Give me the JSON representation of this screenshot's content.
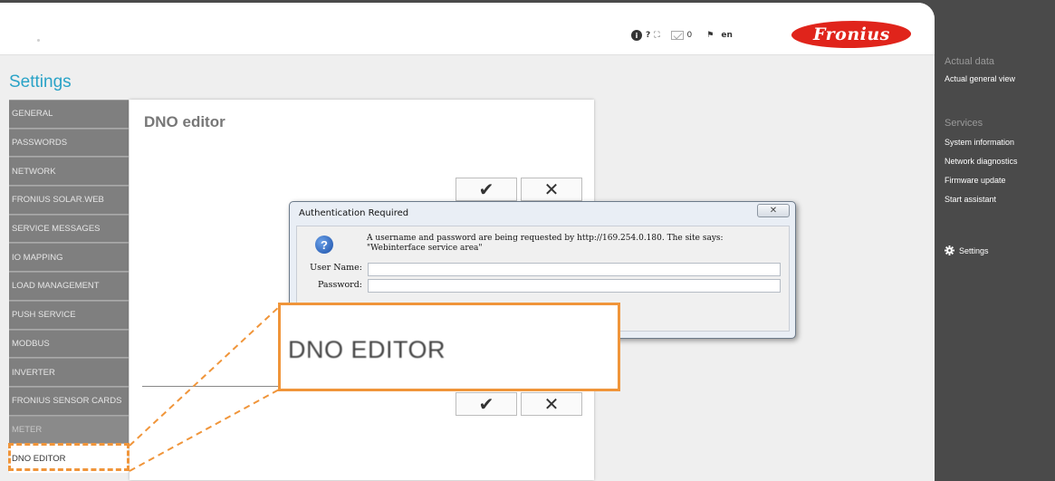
{
  "header": {
    "tools": {
      "info": "i",
      "help": "?",
      "fullscreen": "⛶",
      "mail_count": "0",
      "language": "en"
    },
    "logo_text": "Fronius"
  },
  "page": {
    "title": "Settings"
  },
  "menu": {
    "items": [
      {
        "label": "GENERAL"
      },
      {
        "label": "PASSWORDS"
      },
      {
        "label": "NETWORK"
      },
      {
        "label": "FRONIUS SOLAR.WEB"
      },
      {
        "label": "SERVICE MESSAGES"
      },
      {
        "label": "IO MAPPING"
      },
      {
        "label": "LOAD MANAGEMENT"
      },
      {
        "label": "PUSH SERVICE"
      },
      {
        "label": "MODBUS"
      },
      {
        "label": "INVERTER"
      },
      {
        "label": "FRONIUS SENSOR CARDS"
      },
      {
        "label": "METER"
      },
      {
        "label": "DNO EDITOR"
      }
    ]
  },
  "content": {
    "title": "DNO editor",
    "confirm_glyph": "✔",
    "cancel_glyph": "✕"
  },
  "sidebar": {
    "actual_data_heading": "Actual data",
    "actual_general_view": "Actual general view",
    "services_heading": "Services",
    "system_information": "System information",
    "network_diagnostics": "Network diagnostics",
    "firmware_update": "Firmware update",
    "start_assistant": "Start assistant",
    "settings": "Settings"
  },
  "dialog": {
    "title": "Authentication Required",
    "close_glyph": "✕",
    "message": "A username and password are being requested by http://169.254.0.180. The site says: \"Webinterface service area\"",
    "username_label": "User Name:",
    "password_label": "Password:",
    "username_value": "",
    "password_value": ""
  },
  "callout": {
    "text": "DNO EDITOR"
  },
  "colors": {
    "accent": "#2aa3c7",
    "brand": "#e0241b",
    "highlight": "#f0953a",
    "sidebar_bg": "#4a4a4a",
    "menu_bg": "#7f7f7f"
  }
}
